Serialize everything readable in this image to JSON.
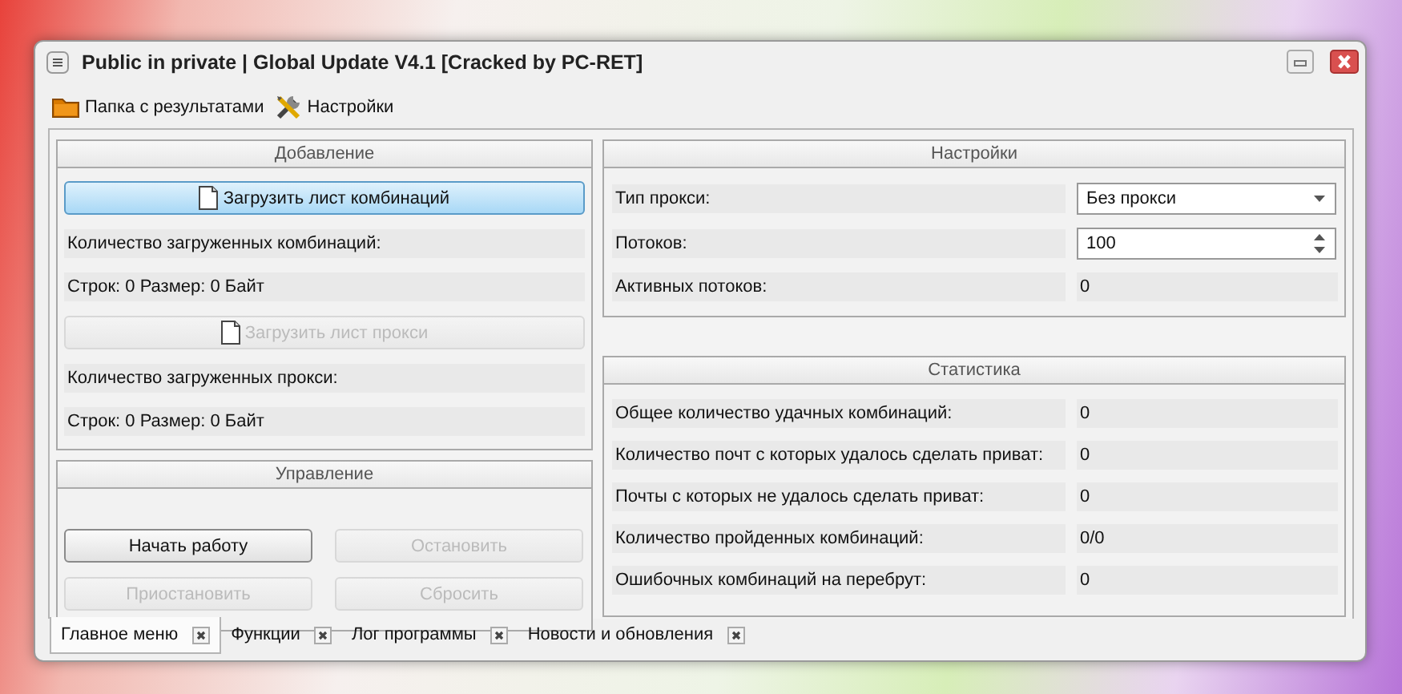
{
  "window": {
    "title": "Public in private | Global Update V4.1 [Cracked by PC-RET]"
  },
  "toolbar": [
    {
      "kind": "folder",
      "label": "Папка с результатами"
    },
    {
      "kind": "tools",
      "label": "Настройки"
    }
  ],
  "adding": {
    "title": "Добавление",
    "items": [
      {
        "kind": "button",
        "label": "Загрузить лист комбинаций",
        "disabled": false,
        "focused": true
      },
      {
        "kind": "text",
        "label": "Количество загруженных комбинаций:"
      },
      {
        "kind": "text",
        "label": "Строк: 0 Размер: 0 Байт"
      },
      {
        "kind": "button",
        "label": "Загрузить лист прокси",
        "disabled": true,
        "focused": false
      },
      {
        "kind": "text",
        "label": "Количество загруженных прокси:"
      },
      {
        "kind": "text",
        "label": "Строк: 0 Размер: 0 Байт"
      }
    ]
  },
  "control": {
    "title": "Управление",
    "buttons": [
      {
        "label": "Начать работу",
        "disabled": false
      },
      {
        "label": "Остановить",
        "disabled": true
      },
      {
        "label": "Приостановить",
        "disabled": true
      },
      {
        "label": "Сбросить",
        "disabled": true
      }
    ]
  },
  "settings": {
    "title": "Настройки",
    "rows": [
      {
        "kind": "dropdown",
        "label": "Тип прокси:",
        "value": "Без прокси"
      },
      {
        "kind": "spinner",
        "label": "Потоков:",
        "value": "100"
      },
      {
        "kind": "readout",
        "label": "Активных потоков:",
        "value": "0"
      }
    ]
  },
  "statistics": {
    "title": "Статистика",
    "rows": [
      {
        "label": "Общее количество удачных комбинаций:",
        "value": "0"
      },
      {
        "label": "Количество почт с которых удалось сделать приват:",
        "value": "0"
      },
      {
        "label": "Почты с которых не удалось сделать приват:",
        "value": "0"
      },
      {
        "label": "Количество пройденных комбинаций:",
        "value": "0/0"
      },
      {
        "label": "Ошибочных комбинаций на перебрут:",
        "value": "0"
      }
    ]
  },
  "tabs": [
    {
      "label": "Главное меню",
      "selected": true
    },
    {
      "label": "Функции",
      "selected": false
    },
    {
      "label": "Лог программы",
      "selected": false
    },
    {
      "label": "Новости и обновления",
      "selected": false
    }
  ]
}
